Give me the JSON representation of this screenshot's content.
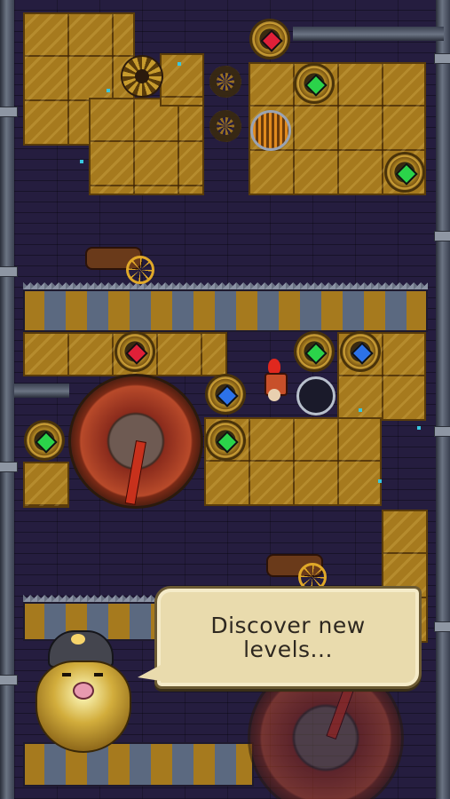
{
  "game": {
    "tutorial": {
      "message": "Discover new\nlevels..."
    },
    "scene": {
      "gems": [
        {
          "color": "red"
        },
        {
          "color": "green"
        },
        {
          "color": "green"
        },
        {
          "color": "red"
        },
        {
          "color": "green"
        },
        {
          "color": "blue"
        },
        {
          "color": "blue"
        },
        {
          "color": "green"
        },
        {
          "color": "green"
        }
      ]
    },
    "colors": {
      "background": "#211a38",
      "gold_block": "#a67a1e",
      "bubble_fill": "#e9dbad",
      "bubble_text": "#2e2820"
    }
  }
}
